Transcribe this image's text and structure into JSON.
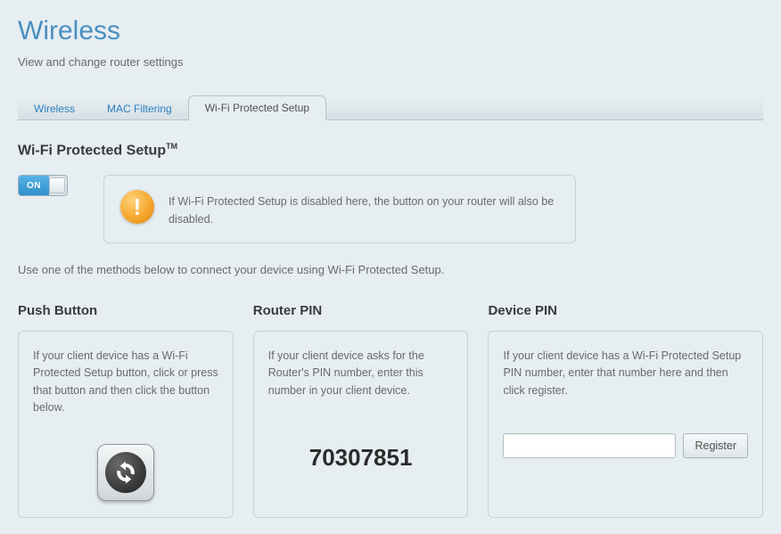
{
  "header": {
    "title": "Wireless",
    "subtitle": "View and change router settings"
  },
  "tabs": [
    {
      "label": "Wireless",
      "active": false
    },
    {
      "label": "MAC Filtering",
      "active": false
    },
    {
      "label": "Wi-Fi Protected Setup",
      "active": true
    }
  ],
  "section": {
    "heading": "Wi-Fi Protected Setup",
    "tm": "TM",
    "toggle_label": "ON",
    "warning": "If Wi-Fi Protected Setup is disabled here, the button on your router will also be disabled.",
    "helper": "Use one of the methods below to connect your device using Wi-Fi Protected Setup."
  },
  "columns": {
    "push": {
      "title": "Push Button",
      "text": "If your client device has a Wi-Fi Protected Setup button, click or press that button and then click the button below."
    },
    "router": {
      "title": "Router PIN",
      "text": "If your client device asks for the Router's PIN number, enter this number in your client device.",
      "pin": "70307851"
    },
    "device": {
      "title": "Device PIN",
      "text": "If your client device has a Wi-Fi Protected Setup PIN number, enter that number here and then click register.",
      "input_value": "",
      "register_label": "Register"
    }
  }
}
